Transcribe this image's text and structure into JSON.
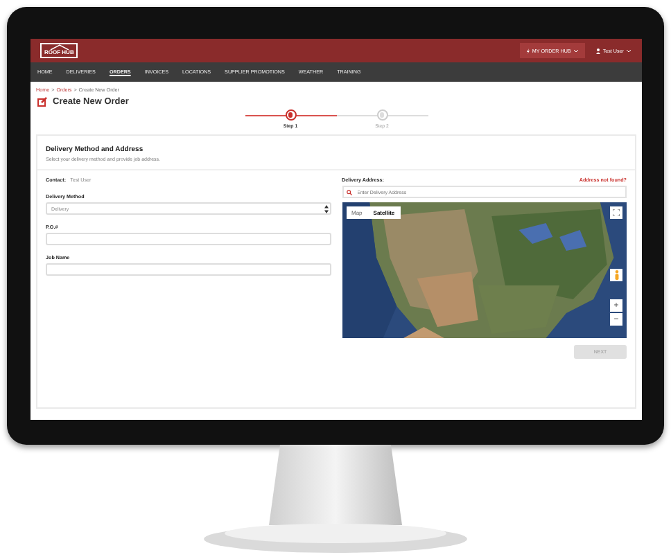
{
  "header": {
    "logo": "ROOF HUB",
    "order_hub_button": "MY ORDER HUB",
    "user_menu": "Test User"
  },
  "nav": [
    {
      "label": "HOME",
      "selected": false
    },
    {
      "label": "DELIVERIES",
      "selected": false
    },
    {
      "label": "ORDERS",
      "selected": true
    },
    {
      "label": "INVOICES",
      "selected": false
    },
    {
      "label": "LOCATIONS",
      "selected": false
    },
    {
      "label": "SUPPLIER PROMOTIONS",
      "selected": false
    },
    {
      "label": "WEATHER",
      "selected": false
    },
    {
      "label": "TRAINING",
      "selected": false
    }
  ],
  "breadcrumb": [
    {
      "kind": "link",
      "text": "Home"
    },
    {
      "kind": "separator",
      "text": ">"
    },
    {
      "kind": "link",
      "text": "Orders"
    },
    {
      "kind": "separator",
      "text": ">"
    },
    {
      "kind": "current",
      "text": "Create New Order"
    }
  ],
  "page_title": "Create New Order",
  "steps": [
    {
      "label": "Step 1",
      "selected": true
    },
    {
      "label": "Step 2",
      "selected": false
    }
  ],
  "section": {
    "title": "Delivery Method and Address",
    "subtitle": "Select your delivery method and provide job address."
  },
  "contact": {
    "label": "Contact:",
    "value": "Test User"
  },
  "fields": [
    {
      "kind": "select",
      "label": "Delivery Method",
      "value": "Delivery"
    },
    {
      "kind": "text",
      "label": "P.O.#"
    },
    {
      "kind": "text",
      "label": "Job Name"
    }
  ],
  "address": {
    "label": "Delivery Address:",
    "link": "Address not found?",
    "placeholder": "Enter Delivery Address"
  },
  "map": {
    "kind": "picture",
    "map_types": [
      {
        "label": "Map",
        "selected": false
      },
      {
        "label": "Satellite",
        "selected": true
      }
    ],
    "zoom_in": "+",
    "zoom_out": "−"
  },
  "next_button": {
    "label": "NEXT",
    "disabled": true
  }
}
